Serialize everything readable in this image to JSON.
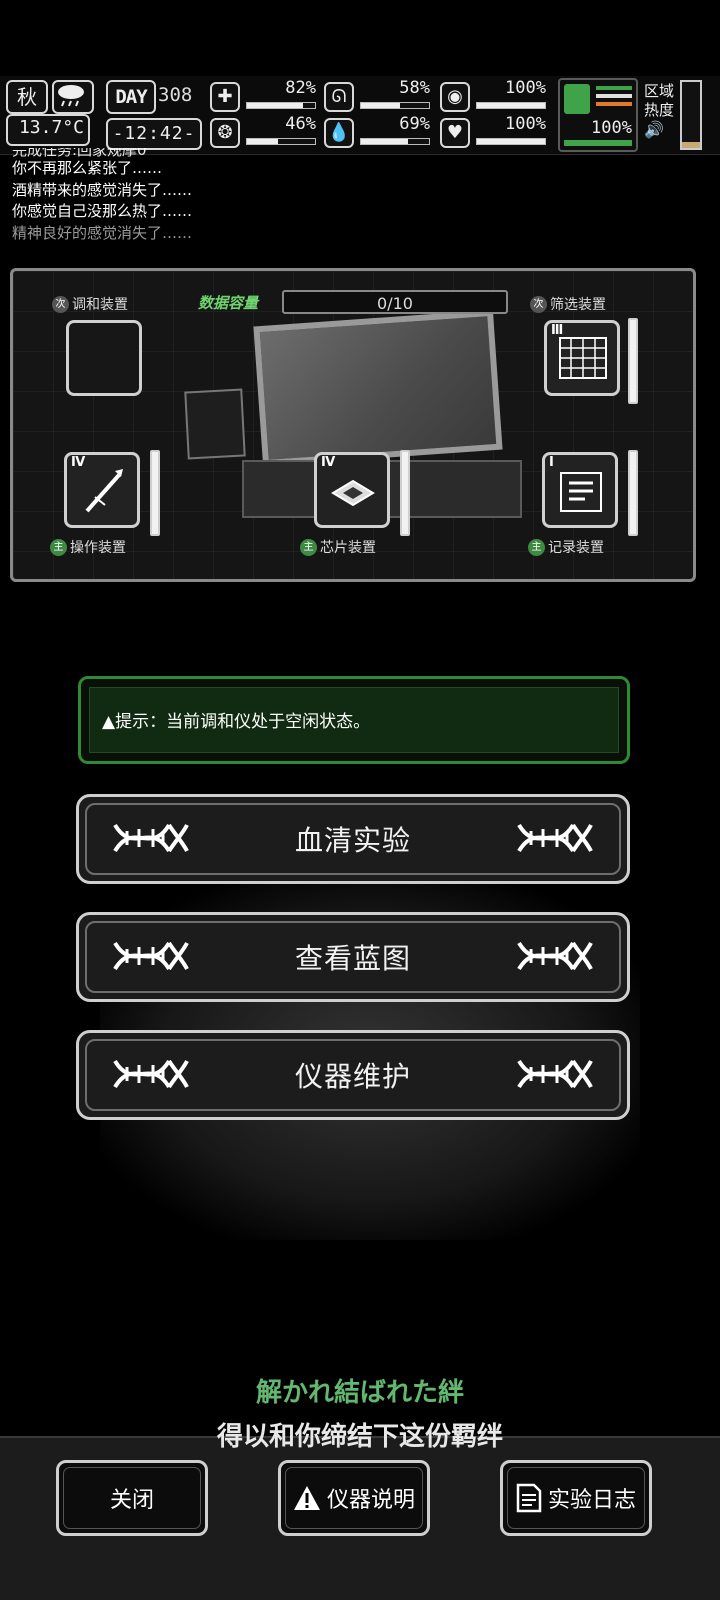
{
  "hud": {
    "season": "秋",
    "temperature": "13.7°C",
    "day_label": "DAY",
    "day_number": "308",
    "clock": "-12:42-",
    "stats": [
      {
        "name": "health",
        "value": "82%",
        "fraction": 0.82
      },
      {
        "name": "stomach",
        "value": "58%",
        "fraction": 0.58
      },
      {
        "name": "stamina",
        "value": "100%",
        "fraction": 1.0
      },
      {
        "name": "mind",
        "value": "46%",
        "fraction": 0.46
      },
      {
        "name": "water",
        "value": "69%",
        "fraction": 0.69
      },
      {
        "name": "heart",
        "value": "100%",
        "fraction": 1.0
      }
    ],
    "foot_value": "100%",
    "region_label_1": "区域",
    "region_label_2": "热度"
  },
  "log": {
    "lines": [
      "完成任务:回家规摩0",
      "你不再那么紧张了……",
      "酒精带来的感觉消失了……",
      "你感觉自己没那么热了……",
      "精神良好的感觉消失了……"
    ]
  },
  "panel": {
    "capacity_label": "数据容量",
    "capacity_value": "0/10",
    "slots": {
      "tune": {
        "tag": "次",
        "label": "调和装置"
      },
      "filter": {
        "tag": "次",
        "label": "筛选装置",
        "level": "Ⅲ"
      },
      "operate": {
        "tag": "主",
        "label": "操作装置",
        "level": "Ⅳ"
      },
      "chip": {
        "tag": "主",
        "label": "芯片装置",
        "level": "Ⅳ"
      },
      "record": {
        "tag": "主",
        "label": "记录装置",
        "level": "Ⅰ"
      }
    }
  },
  "tip": {
    "text": "▲提示：当前调和仪处于空闲状态。"
  },
  "actions": {
    "serum": "血清实验",
    "blueprint": "查看蓝图",
    "maintain": "仪器维护"
  },
  "lyrics": {
    "jp": "解かれ結ばれた絆",
    "cn": "得以和你缔结下这份羁绊"
  },
  "bottom": {
    "close": "关闭",
    "manual": "仪器说明",
    "log": "实验日志"
  },
  "colors": {
    "accent_green": "#2f8a34",
    "lyric_green": "#63b86f",
    "main_tag": "#3f8a43"
  }
}
